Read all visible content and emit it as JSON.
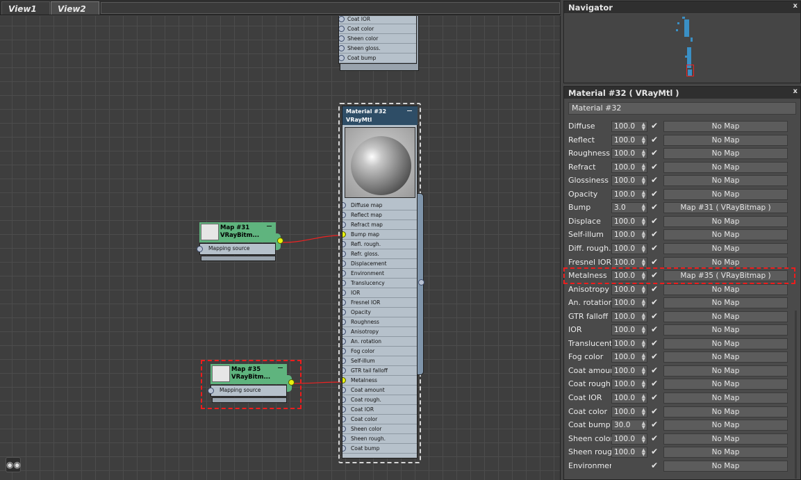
{
  "tabs": [
    {
      "label": "View1",
      "active": false
    },
    {
      "label": "View2",
      "active": true
    }
  ],
  "top_node": {
    "rows": [
      "Coat IOR",
      "Coat color",
      "Sheen color",
      "Sheen gloss.",
      "Coat bump"
    ]
  },
  "material_node": {
    "title": "Material #32",
    "subtitle": "VRayMtl",
    "slots": [
      "Diffuse map",
      "Reflect map",
      "Refract map",
      "Bump map",
      "Refl. rough.",
      "Refr. gloss.",
      "Displacement",
      "Environment",
      "Translucency",
      "IOR",
      "Fresnel IOR",
      "Opacity",
      "Roughness",
      "Anisotropy",
      "An. rotation",
      "Fog color",
      "Self-illum",
      "GTR tail falloff",
      "Metalness",
      "Coat amount",
      "Coat rough.",
      "Coat IOR",
      "Coat color",
      "Sheen color",
      "Sheen rough.",
      "Coat bump"
    ]
  },
  "map_nodes": [
    {
      "title": "Map #31",
      "subtitle": "VRayBitm...",
      "input": "Mapping source"
    },
    {
      "title": "Map #35",
      "subtitle": "VRayBitm...",
      "input": "Mapping source"
    }
  ],
  "navigator": {
    "title": "Navigator",
    "close": "x"
  },
  "params_panel": {
    "title": "Material #32  ( VRayMtl )",
    "close": "x",
    "name_field": "Material #32",
    "rows": [
      {
        "label": "Diffuse",
        "value": "100.0",
        "map": "No Map"
      },
      {
        "label": "Reflect",
        "value": "100.0",
        "map": "No Map"
      },
      {
        "label": "Roughness",
        "value": "100.0",
        "map": "No Map"
      },
      {
        "label": "Refract",
        "value": "100.0",
        "map": "No Map"
      },
      {
        "label": "Glossiness",
        "value": "100.0",
        "map": "No Map"
      },
      {
        "label": "Opacity",
        "value": "100.0",
        "map": "No Map"
      },
      {
        "label": "Bump",
        "value": "3.0",
        "map": "Map #31  ( VRayBitmap )"
      },
      {
        "label": "Displace",
        "value": "100.0",
        "map": "No Map"
      },
      {
        "label": "Self-illum",
        "value": "100.0",
        "map": "No Map"
      },
      {
        "label": "Diff. rough.",
        "value": "100.0",
        "map": "No Map"
      },
      {
        "label": "Fresnel IOR",
        "value": "100.0",
        "map": "No Map"
      },
      {
        "label": "Metalness",
        "value": "100.0",
        "map": "Map #35  ( VRayBitmap )"
      },
      {
        "label": "Anisotropy",
        "value": "100.0",
        "map": "No Map"
      },
      {
        "label": "An. rotation",
        "value": "100.0",
        "map": "No Map"
      },
      {
        "label": "GTR falloff",
        "value": "100.0",
        "map": "No Map"
      },
      {
        "label": "IOR",
        "value": "100.0",
        "map": "No Map"
      },
      {
        "label": "Translucent",
        "value": "100.0",
        "map": "No Map"
      },
      {
        "label": "Fog color",
        "value": "100.0",
        "map": "No Map"
      },
      {
        "label": "Coat amoun",
        "value": "100.0",
        "map": "No Map"
      },
      {
        "label": "Coat rough",
        "value": "100.0",
        "map": "No Map"
      },
      {
        "label": "Coat IOR",
        "value": "100.0",
        "map": "No Map"
      },
      {
        "label": "Coat color",
        "value": "100.0",
        "map": "No Map"
      },
      {
        "label": "Coat bump",
        "value": "30.0",
        "map": "No Map"
      },
      {
        "label": "Sheen color",
        "value": "100.0",
        "map": "No Map"
      },
      {
        "label": "Sheen rougl",
        "value": "100.0",
        "map": "No Map"
      },
      {
        "label": "Environment",
        "value": null,
        "map": "No Map"
      }
    ]
  },
  "colors": {
    "wire": "#ee2222",
    "highlight_dash": "#ee1c1c",
    "live_socket": "#e8f20f",
    "map_node": "#5fb47e",
    "material_header": "#2e4d66"
  },
  "icons": {
    "find": "binoculars-icon",
    "check": "checkmark-icon",
    "spinner": "spinner-arrows-icon",
    "close": "close-icon"
  }
}
